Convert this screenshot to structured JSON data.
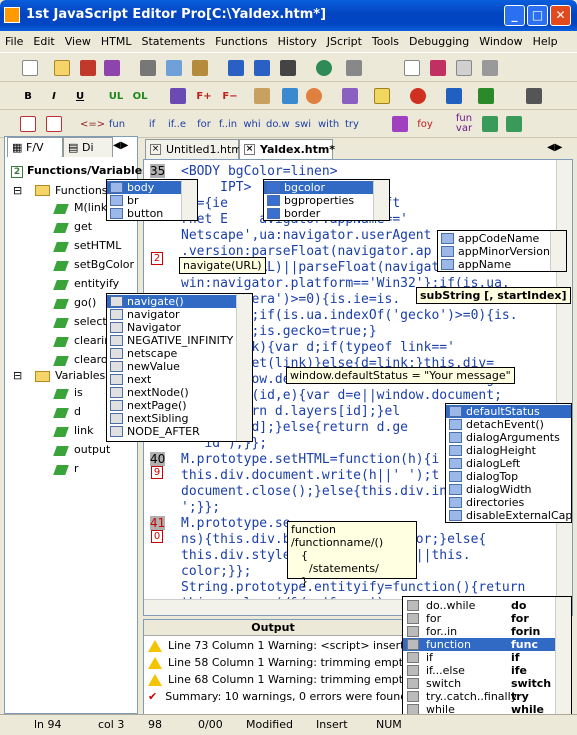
{
  "window": {
    "title": "1st JavaScript Editor Pro[C:\\Yaldex.htm*]"
  },
  "menu": [
    "File",
    "Edit",
    "View",
    "HTML",
    "Statements",
    "Functions",
    "History",
    "JScript",
    "Tools",
    "Debugging",
    "Window",
    "Help"
  ],
  "toolbar2": {
    "b": "B",
    "i": "I",
    "u": "U",
    "ul": "UL",
    "ol": "OL",
    "fplus": "F+",
    "fminus": "F−"
  },
  "toolbar3": {
    "tag": "<=>",
    "fun": "fun",
    "if": "if",
    "ife": "if..e",
    "for": "for",
    "forin": "f..in",
    "whi": "whi",
    "dow": "do.w",
    "swi": "swi",
    "with": "with",
    "try": "try",
    "foy": "foy",
    "funvar_top": "fun",
    "funvar_bot": "var"
  },
  "left_tabs": [
    "F/V",
    "Di"
  ],
  "tree": {
    "functions_header": "Functions/Variables",
    "functions_label": "Functions",
    "functions": [
      "M(link)",
      "get",
      "setHTML",
      "setBgColor",
      "entityify",
      "go()",
      "selecti",
      "clearin",
      "clearo"
    ],
    "variables_label": "Variables",
    "variables": [
      "is",
      "d",
      "link",
      "output",
      "r"
    ]
  },
  "doc_tabs": [
    "Untitled1.htm",
    "Yaldex.htm*"
  ],
  "gutter": {
    "lines": [
      "35",
      "40",
      "41"
    ],
    "marks": [
      "2",
      "9",
      "0"
    ]
  },
  "code_lines": [
    "<BODY bgColor=linen>",
    "     IPT>",
    "is={ie      name=='Microsoft",
    "rnet E    avigator.appName=='",
    "Netscape',ua:navigator.userAgent",
    ".version:parseFloat(navigator.ap",
    "navigate(URL)||parseFloat(navigato",
    "win:navigator.platform=='Win32'};if(is.ua.",
    "       opera')>=0){is.ie=is.",
    "     :e:};if(is.ua.indexOf('gecko')>=0){is.",
    "    false;is.gecko=true;}",
    "    M(link){var d;if(typeof link=='",
    "    d=M.get(link)}else{d=link;}this.div=",
    "     window.defaultStatus = \"Your message\"",
    "    ction(id,e){var d=e||window.document;",
    "    {return d.layers[id];}el",
    "    all[id];}else{return d.ge",
    "  'id');}};",
    "M.prototype.setHTML=function(h){i",
    "this.div.document.write(h||' ');t",
    "document.close();}else{this.div.in",
    "';}};",
    "M.prototype.se",
    "ns){this.div.b          is.color;}else{",
    "this.div.style           color||this.",
    "color;}};",
    "String.prototype.entityify=function(){return",
    "this.replace(/&/g,'&amp;').r"
  ],
  "popups": {
    "tags": [
      "body",
      "br",
      "button"
    ],
    "bgcolor": [
      "bgcolor",
      "bgproperties",
      "border"
    ],
    "navigator_props": [
      "appCodeName",
      "appMinorVersion",
      "appName"
    ],
    "navigate_list": [
      "navigate()",
      "navigator",
      "Navigator",
      "NEGATIVE_INFINITY",
      "netscape",
      "newValue",
      "next",
      "nextNode()",
      "nextPage()",
      "nextSibling",
      "NODE_AFTER"
    ],
    "window_props": [
      "defaultStatus",
      "detachEvent()",
      "dialogArguments",
      "dialogHeight",
      "dialogLeft",
      "dialogTop",
      "dialogWidth",
      "directories",
      "disableExternalCap"
    ]
  },
  "tooltips": {
    "navigate": "navigate(URL)",
    "substring": "subString [, startIndex]",
    "defaultstatus": "window.defaultStatus = \"Your message\"",
    "function_tpl_1": "function /functionname/()",
    "function_tpl_2": "{",
    "function_tpl_3": "/statements/",
    "function_tpl_4": "}"
  },
  "output": {
    "title": "Output",
    "rows": [
      "Line 73 Column 1  Warning: <script> inserting \"typ",
      "Line 58 Column 1  Warning: trimming empty <p>",
      "Line 68 Column 1  Warning: trimming empty <p>",
      "Summary: 10 warnings, 0 errors were found!"
    ]
  },
  "snippets": [
    {
      "a": "do..while",
      "b": "do"
    },
    {
      "a": "for",
      "b": "for"
    },
    {
      "a": "for..in",
      "b": "forin"
    },
    {
      "a": "function",
      "b": "func"
    },
    {
      "a": "if",
      "b": "if"
    },
    {
      "a": "if...else",
      "b": "ife"
    },
    {
      "a": "switch",
      "b": "switch"
    },
    {
      "a": "try..catch..finally",
      "b": "try"
    },
    {
      "a": "while",
      "b": "while"
    },
    {
      "a": "with",
      "b": "with"
    }
  ],
  "status": {
    "line": "ln 94",
    "col": "col 3",
    "pos": "98",
    "ratio": "0/00",
    "mod": "Modified",
    "ins": "Insert",
    "num": "NUM"
  }
}
